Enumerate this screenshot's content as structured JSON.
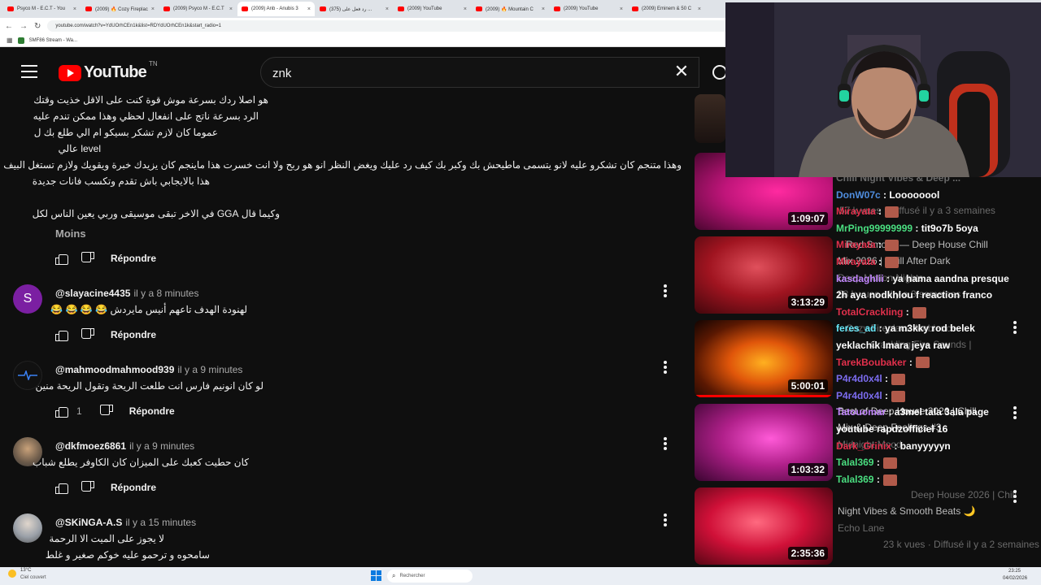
{
  "browser": {
    "tabs": [
      {
        "label": "Psyco M - E.C.T - You"
      },
      {
        "label": "(2009) 🔥 Cozy Fireplac"
      },
      {
        "label": "(2009) Psyco M - E.C.T"
      },
      {
        "label": "(2009) Anb - Anubis 3",
        "active": true
      },
      {
        "label": "(375) رد فعل على ..."
      },
      {
        "label": "(2009) YouTube"
      },
      {
        "label": "(2009) 🔥 Mountain C"
      },
      {
        "label": "(2009) YouTube"
      },
      {
        "label": "(2009) Eminem & 50 C"
      }
    ],
    "url": "youtube.com/watch?v=YdUOrhCEn1k&list=RDYdUOrhCEn1k&start_radio=1",
    "bookmark": "SMF86 Stream - Wa..."
  },
  "header": {
    "logo_text": "YouTube",
    "logo_suffix": "TN",
    "search_value": "znk"
  },
  "comments": {
    "expanded_lines": [
      "هو اصلا ردك بسرعة موش قوة كنت على الاقل خذيت وقتك",
      "الرد بسرعة ناتج على انفعال لحظي وهذا ممكن تندم عليه",
      "عموما كان لازم تشكر بسيكو ام الي طلع بك ل",
      "level عالي",
      "وهذا متنجم كان تشكرو عليه لانو يتسمى ماطيحش بك وكبر بك كيف رد عليك ويغض النظر انو هو ربح ولا انت خسرت هذا ماينجم كان يزيدك خبرة ويقويك ولازم تستغل البيف",
      "هذا بالايجابي باش تقدم وتكسب فانات جديدة",
      "وكيما قال GGA في الاخر تبقى موسيقى وربي يعين الناس لكل"
    ],
    "less_label": "Moins",
    "reply_label": "Répondre",
    "items": [
      {
        "author": "@slayacine4435",
        "time": "il y a 8 minutes",
        "text": "لهنودة الهدف تاعهم أنيس مايردش 😂 😂 😂 😂",
        "avatar_letter": "S",
        "likes": ""
      },
      {
        "author": "@mahmoodmahmood939",
        "time": "il y a 9 minutes",
        "text": "لو كان انونيم فارس انت طلعت الريحة وتقول الريحة منين",
        "avatar_letter": "",
        "likes": "1"
      },
      {
        "author": "@dkfmoez6861",
        "time": "il y a 9 minutes",
        "text": "كان حطيت كعبك على الميزان كان الكاوفر يطلع شباب",
        "avatar_letter": "",
        "likes": ""
      },
      {
        "author": "@SKiNGA-A.S",
        "time": "il y a 15 minutes",
        "text": "لا يجوز على الميت الا الرحمة",
        "text2": "سامحوه و ترحمو عليه خوكم صغير و غلط",
        "avatar_letter": "",
        "likes": ""
      }
    ]
  },
  "sidebar": {
    "durations": [
      "1:09:07",
      "3:13:29",
      "5:00:01",
      "1:03:32",
      "2:35:36"
    ]
  },
  "chat": {
    "lines": [
      {
        "text": "Chill Night Vibes & Deep ...",
        "user": "",
        "color": "#6a6a6a"
      },
      {
        "user": "DonW07c",
        "text": " : Loooooool",
        "color": "#4f8dde"
      },
      {
        "user": "Mirayata",
        "text": " :",
        "color": "#e2304c"
      },
      {
        "user": "MrPing99999999",
        "text": " : tit9o7b 5oya",
        "color": "#4ade80"
      },
      {
        "user": "Mirayata",
        "text": " :",
        "color": "#e2304c"
      },
      {
        "user": "Mirayata",
        "text": " :",
        "color": "#e2304c"
      },
      {
        "user": "kasdaghlii",
        "text": " : ya hama aandna presque",
        "color": "#c084fc"
      },
      {
        "user": "",
        "text": "2h aya nodkhlou f reaction franco",
        "color": "#ffffff"
      },
      {
        "user": "TotalCrackling",
        "text": " :",
        "color": "#e2304c"
      },
      {
        "user": "feres_ad",
        "text": " : ya m3kky rod belek",
        "color": "#67e8f9"
      },
      {
        "user": "",
        "text": "yeklachik lmara jeya raw",
        "color": "#ffffff"
      },
      {
        "user": "TarekBoubaker",
        "text": " :",
        "color": "#e2304c"
      },
      {
        "user": "P4r4d0x4l",
        "text": " :",
        "color": "#7c6cf0"
      },
      {
        "user": "P4r4d0x4l",
        "text": " :",
        "color": "#7c6cf0"
      },
      {
        "user": "Tatouomar",
        "text": " : a3mel tala 3ala page",
        "color": "#c084fc"
      },
      {
        "user": "",
        "text": "youtube rapdzofficiel 16",
        "color": "#ffffff"
      },
      {
        "user": "Dark_Grinix",
        "text": " : banyyyyyn",
        "color": "#e2304c"
      },
      {
        "user": "Talal369",
        "text": " :",
        "color": "#4ade80"
      },
      {
        "user": "Talal369",
        "text": " :",
        "color": "#4ade80"
      }
    ],
    "ghost_lines": [
      "57 k vues · Diffusé il y a 3 semaines",
      "Red Smoke — Deep House Chill",
      "Mix 2026 | Chill After Dark",
      "Deep Motion Nights",
      "58 k vues · il y a 3 semaines",
      "Cozy Fireplace Ambience",
      "Crackling Fire Sounds |",
      "Best of Deep House 2026 | Chill",
      "Mix & Deep Feelings #3",
      "Midnight Mood",
      "Deep House 2026 | Chill",
      "Night Vibes & Smooth Beats 🌙",
      "Echo Lane",
      "23 k vues · Diffusé il y a 2 semaines"
    ]
  },
  "taskbar": {
    "weather_temp": "13°C",
    "weather_desc": "Ciel couvert",
    "search_placeholder": "Rechercher",
    "time": "23:25",
    "date": "04/02/2026"
  }
}
